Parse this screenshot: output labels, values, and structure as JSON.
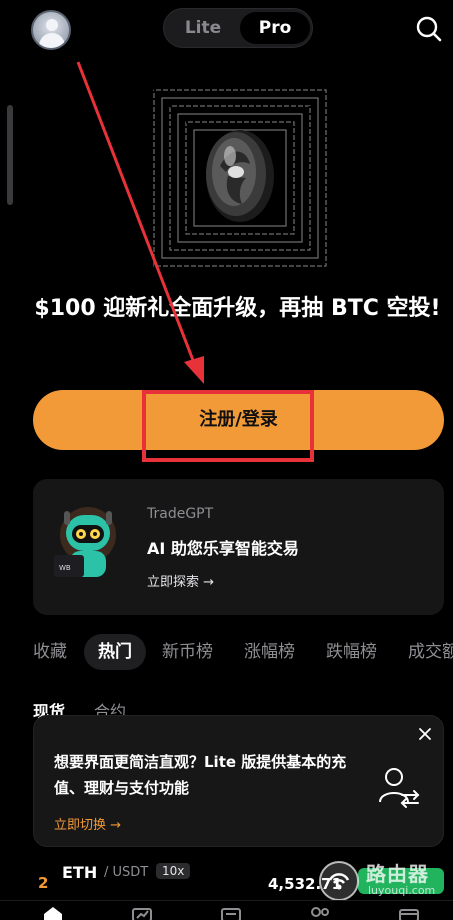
{
  "header": {
    "mode_lite": "Lite",
    "mode_pro": "Pro",
    "avatar_icon": "user-avatar-icon",
    "search_icon": "search-icon"
  },
  "hero": {
    "title": "$100 迎新礼全面升级，再抽 BTC 空投!",
    "register_label": "注册/登录"
  },
  "gpt_card": {
    "name": "TradeGPT",
    "description": "AI 助您乐享智能交易",
    "link": "立即探索 →"
  },
  "category_tabs": [
    {
      "label": "收藏"
    },
    {
      "label": "热门"
    },
    {
      "label": "新币榜"
    },
    {
      "label": "涨幅榜"
    },
    {
      "label": "跌幅榜"
    },
    {
      "label": "成交额"
    }
  ],
  "category_active": "热门",
  "sub_tabs": [
    {
      "label": "现货"
    },
    {
      "label": "合约"
    }
  ],
  "lite_card": {
    "text": "想要界面更简洁直观？Lite 版提供基本的充值、理财与支付功能",
    "link": "立即切换 →"
  },
  "market_row": {
    "rank": "2",
    "base": "ETH",
    "quote": "/ USDT",
    "leverage": "10x",
    "price": "4,532.71"
  },
  "watermark": {
    "text": "路由器",
    "url": "luyouqi.com"
  },
  "colors": {
    "accent": "#f29a38",
    "highlight": "#e8323a",
    "up": "#22b35e",
    "background": "#000000"
  }
}
